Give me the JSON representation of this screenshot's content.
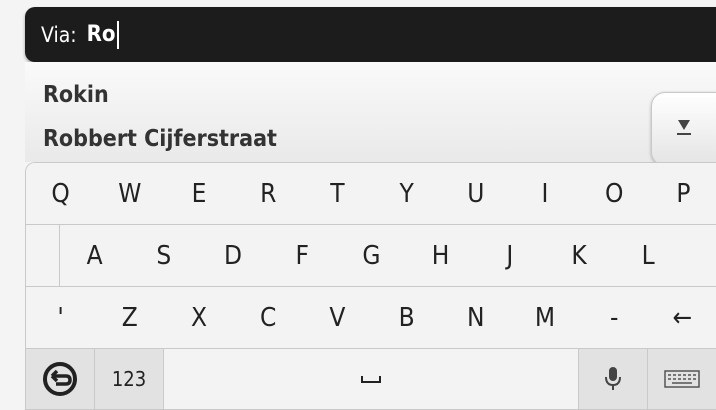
{
  "search": {
    "prefix": "Via:",
    "value": "Ro"
  },
  "suggestions": [
    "Rokin",
    "Robbert Cijferstraat"
  ],
  "keyboard": {
    "row1": [
      "Q",
      "W",
      "E",
      "R",
      "T",
      "Y",
      "U",
      "I",
      "O",
      "P"
    ],
    "row2": [
      "A",
      "S",
      "D",
      "F",
      "G",
      "H",
      "J",
      "K",
      "L"
    ],
    "row3": [
      "'",
      "Z",
      "X",
      "C",
      "V",
      "B",
      "N",
      "M",
      "-"
    ],
    "numbers_label": "123",
    "backspace_glyph": "←"
  },
  "icons": {
    "back": "back-icon",
    "scroll": "scroll-down-icon",
    "space": "space-icon",
    "mic": "microphone-icon",
    "keyboard": "keyboard-icon"
  },
  "colors": {
    "search_bar_bg": "#1c1c1c",
    "key_bg": "#f3f3f3",
    "key_border": "#c9c9c9"
  }
}
